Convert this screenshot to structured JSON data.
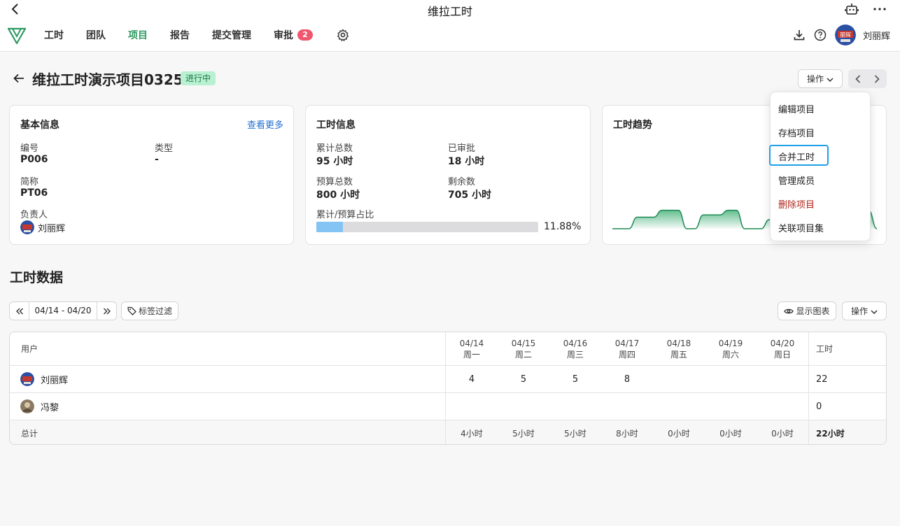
{
  "app": {
    "title": "维拉工时"
  },
  "nav": {
    "items": [
      {
        "label": "工时",
        "active": false
      },
      {
        "label": "团队",
        "active": false
      },
      {
        "label": "项目",
        "active": true
      },
      {
        "label": "报告",
        "active": false
      },
      {
        "label": "提交管理",
        "active": false
      },
      {
        "label": "审批",
        "active": false,
        "badge": "2"
      }
    ],
    "user_name": "刘丽辉",
    "avatar_text": "丽辉"
  },
  "project": {
    "title": "维拉工时演示项目0325",
    "status": "进行中",
    "op_label": "操作"
  },
  "basic_info": {
    "title": "基本信息",
    "more_link": "查看更多",
    "code_label": "编号",
    "code_value": "P006",
    "type_label": "类型",
    "type_value": "-",
    "abbr_label": "简称",
    "abbr_value": "PT06",
    "owner_label": "负责人",
    "owner_name": "刘丽辉"
  },
  "hours_info": {
    "title": "工时信息",
    "total_label": "累计总数",
    "total_value": "95 小时",
    "approved_label": "已审批",
    "approved_value": "18 小时",
    "budget_label": "预算总数",
    "budget_value": "800 小时",
    "remaining_label": "剩余数",
    "remaining_value": "705 小时",
    "ratio_label": "累计/预算占比",
    "ratio_value": "11.88%",
    "ratio_fraction": 0.1188
  },
  "trend": {
    "title": "工时趋势"
  },
  "chart_data": {
    "type": "area",
    "title": "工时趋势",
    "values": [
      0,
      0,
      0,
      1,
      1,
      1,
      1.6,
      1.6,
      1.6,
      0,
      0,
      1.2,
      1.2,
      1.2,
      1.6,
      1.6,
      0,
      0,
      0,
      0.8,
      0.8,
      1.6,
      1.6,
      0,
      0,
      0,
      0,
      0,
      1.2,
      1.2,
      1.6,
      1.6,
      0
    ],
    "grid": false,
    "legend": "none",
    "color": "#2fa86a"
  },
  "dropdown": {
    "items": [
      {
        "label": "编辑项目",
        "danger": false
      },
      {
        "label": "存档项目",
        "danger": false
      },
      {
        "label": "合并工时",
        "danger": false,
        "focused": true
      },
      {
        "label": "管理成员",
        "danger": false
      },
      {
        "label": "删除项目",
        "danger": true
      },
      {
        "label": "关联项目集",
        "danger": false
      }
    ]
  },
  "data_section": {
    "title": "工时数据",
    "date_range": "04/14 - 04/20",
    "tag_filter": "标签过滤",
    "show_chart": "显示图表",
    "op_label": "操作"
  },
  "table": {
    "user_header": "用户",
    "hours_header": "工时",
    "days": [
      {
        "date": "04/14",
        "weekday": "周一"
      },
      {
        "date": "04/15",
        "weekday": "周二"
      },
      {
        "date": "04/16",
        "weekday": "周三"
      },
      {
        "date": "04/17",
        "weekday": "周四"
      },
      {
        "date": "04/18",
        "weekday": "周五"
      },
      {
        "date": "04/19",
        "weekday": "周六"
      },
      {
        "date": "04/20",
        "weekday": "周日"
      }
    ],
    "rows": [
      {
        "name": "刘丽辉",
        "values": [
          "4",
          "5",
          "5",
          "8",
          "",
          "",
          ""
        ],
        "total": "22"
      },
      {
        "name": "冯黎",
        "values": [
          "",
          "",
          "",
          "",
          "",
          "",
          ""
        ],
        "total": "0"
      }
    ],
    "footer": {
      "label": "总计",
      "values": [
        "4小时",
        "5小时",
        "5小时",
        "8小时",
        "0小时",
        "0小时",
        "0小时"
      ],
      "total": "22小时"
    }
  }
}
